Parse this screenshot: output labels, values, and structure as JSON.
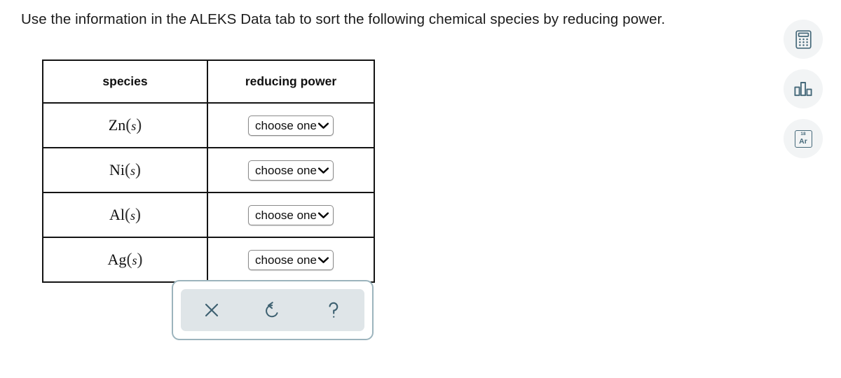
{
  "prompt": {
    "text": "Use the information in the ALEKS Data tab to sort the following chemical species by reducing power."
  },
  "table": {
    "headers": {
      "species": "species",
      "reducing_power": "reducing power"
    },
    "rows": [
      {
        "symbol": "Zn",
        "state": "s",
        "open_paren": "(",
        "close_paren": ")",
        "select_value": "choose one",
        "chevron": "⌄"
      },
      {
        "symbol": "Ni",
        "state": "s",
        "open_paren": "(",
        "close_paren": ")",
        "select_value": "choose one",
        "chevron": "⌄"
      },
      {
        "symbol": "Al",
        "state": "s",
        "open_paren": "(",
        "close_paren": ")",
        "select_value": "choose one",
        "chevron": "⌄"
      },
      {
        "symbol": "Ag",
        "state": "s",
        "open_paren": "(",
        "close_paren": ")",
        "select_value": "choose one",
        "chevron": "⌄"
      }
    ]
  },
  "toolbar": {
    "buttons": [
      {
        "name": "clear",
        "icon": "close-x-icon",
        "label": "×"
      },
      {
        "name": "undo",
        "icon": "undo-arrow-icon",
        "label": "↺"
      },
      {
        "name": "help",
        "icon": "question-mark-icon",
        "label": "?"
      }
    ]
  },
  "sidebar": {
    "items": [
      {
        "name": "calculator",
        "icon": "calculator-icon"
      },
      {
        "name": "data-chart",
        "icon": "bar-chart-icon"
      },
      {
        "name": "periodic-table",
        "icon": "periodic-table-icon",
        "atomic_number": "18",
        "symbol": "Ar"
      }
    ]
  },
  "colors": {
    "icon_teal": "#46697a",
    "toolbar_inner": "#dfe5e8",
    "toolbar_border": "#9cb4bd",
    "sidebar_circle": "#f2f4f5",
    "table_border": "#141414"
  }
}
